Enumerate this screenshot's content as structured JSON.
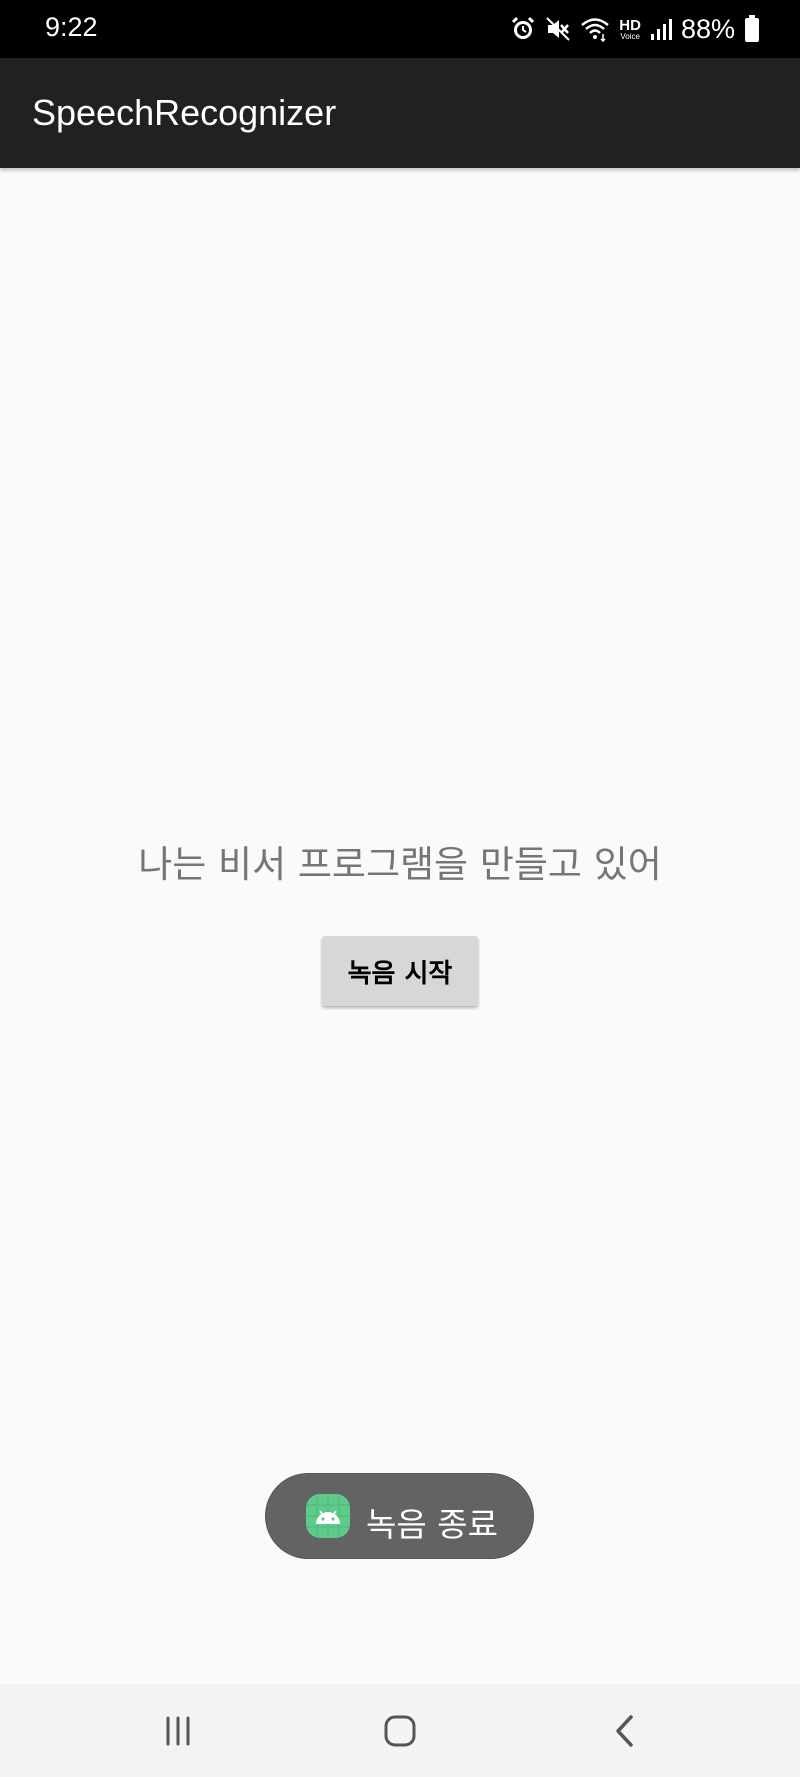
{
  "status_bar": {
    "time": "9:22",
    "hd_label": "HD",
    "voice_label": "Voice",
    "battery_percent": "88%",
    "icons": [
      "alarm-icon",
      "mute-icon",
      "wifi-icon",
      "hd-voice-icon",
      "signal-icon",
      "battery-icon"
    ]
  },
  "app_bar": {
    "title": "SpeechRecognizer"
  },
  "main": {
    "result_text": "나는 비서 프로그램을 만들고 있어",
    "record_button_label": "녹음 시작"
  },
  "toast": {
    "icon": "android-icon",
    "text": "녹음 종료"
  },
  "nav_bar": {
    "icons": [
      "recent-apps-icon",
      "home-icon",
      "back-icon"
    ]
  },
  "colors": {
    "status_bar_bg": "#000000",
    "app_bar_bg": "#212121",
    "page_bg": "#fafafa",
    "result_text": "#757575",
    "button_bg": "#d6d7d7",
    "toast_bg": "#636363",
    "toast_icon_bg": "#5dcb8a"
  }
}
